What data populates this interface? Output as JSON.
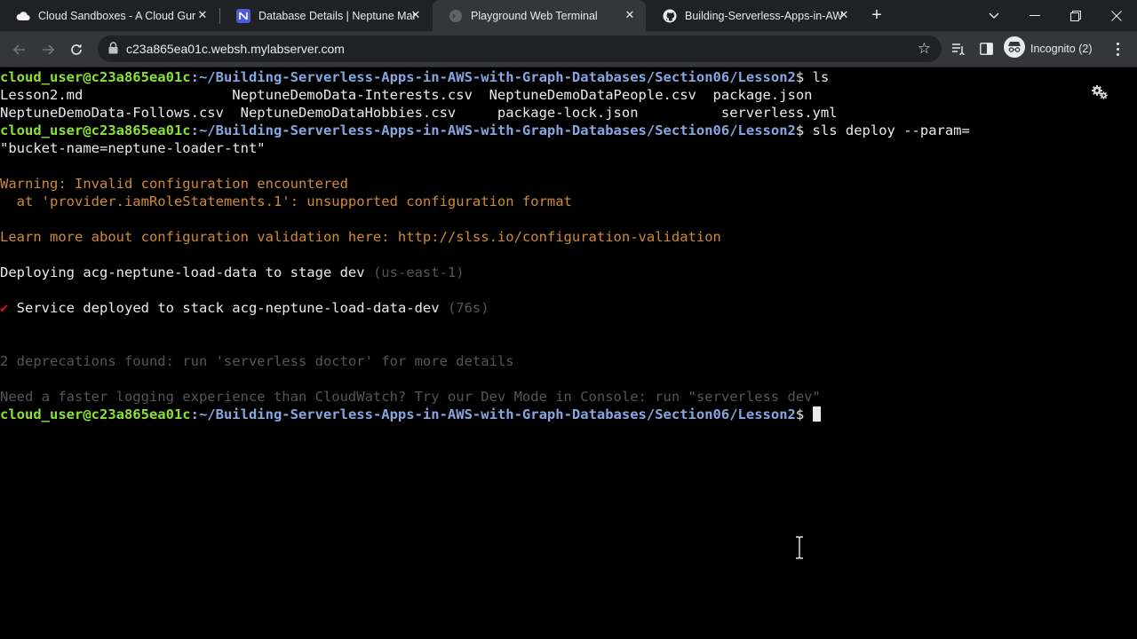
{
  "tabs": [
    {
      "title": "Cloud Sandboxes - A Cloud Guru",
      "icon": "cloud-guru-icon",
      "active": false
    },
    {
      "title": "Database Details | Neptune Mana",
      "icon": "aws-neptune-icon",
      "active": false
    },
    {
      "title": "Playground Web Terminal",
      "icon": "terminal-globe-icon",
      "active": true
    },
    {
      "title": "Building-Serverless-Apps-in-AWS",
      "icon": "github-icon",
      "active": false
    }
  ],
  "toolbar": {
    "url": "c23a865ea01c.websh.mylabserver.com",
    "incognito_label": "Incognito (2)"
  },
  "terminal": {
    "prompt_user": "cloud_user@c23a865ea01c",
    "prompt_path": ":~/Building-Serverless-Apps-in-AWS-with-Graph-Databases/Section06/Lesson2",
    "prompt_suffix": "$ ",
    "cmd1": "ls",
    "ls_row1": "Lesson2.md                  NeptuneDemoData-Interests.csv  NeptuneDemoDataPeople.csv  package.json",
    "ls_row2": "NeptuneDemoData-Follows.csv  NeptuneDemoDataHobbies.csv     package-lock.json          serverless.yml",
    "cmd2": "sls deploy --param=",
    "cmd2_cont": "\"bucket-name=neptune-loader-tnt\"",
    "warning": "Warning: Invalid configuration encountered",
    "warning_detail": "  at 'provider.iamRoleStatements.1': unsupported configuration format",
    "learn_more": "Learn more about configuration validation here: http://slss.io/configuration-validation",
    "deploying": "Deploying acg-neptune-load-data to stage dev ",
    "deploying_region": "(us-east-1)",
    "check_mark": "✔",
    "deployed": " Service deployed to stack acg-neptune-load-data-dev ",
    "deployed_time": "(76s)",
    "deprecations": "2 deprecations found: run 'serverless doctor' for more details",
    "dev_mode": "Need a faster logging experience than CloudWatch? Try our Dev Mode in Console: run \"serverless dev\""
  },
  "colors": {
    "prompt_user": "#8ae234",
    "prompt_path": "#87a6e0",
    "warning": "#d08a33",
    "muted": "#555555",
    "check": "#d0162b"
  }
}
